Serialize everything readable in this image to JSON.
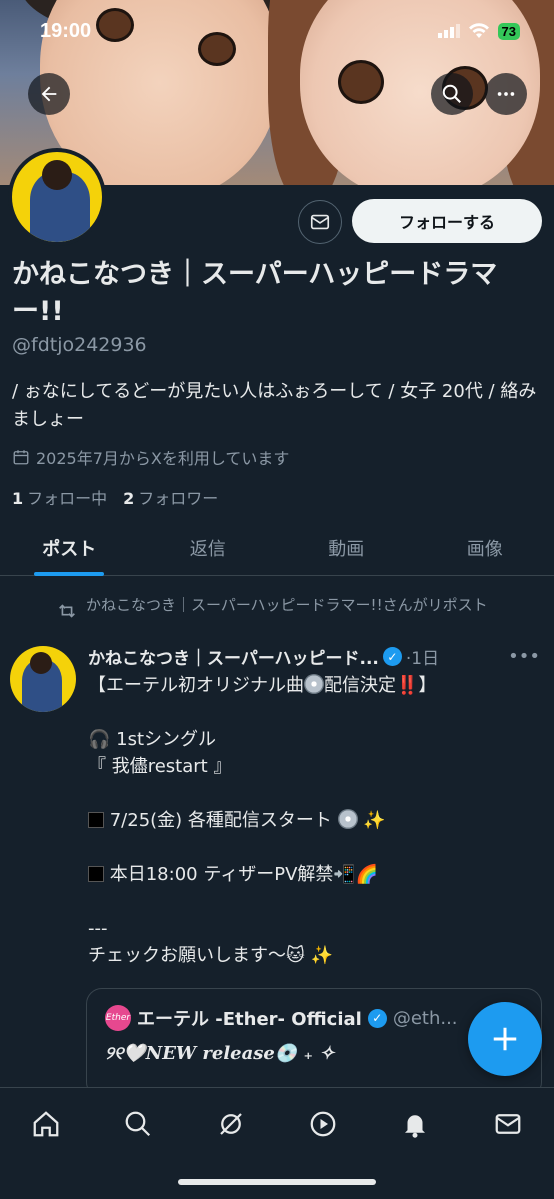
{
  "status_bar": {
    "time": "19:00",
    "battery": "73"
  },
  "profile": {
    "display_name": "かねこなつき｜スーパーハッピードラマー!!",
    "handle": "@fdtjo242936",
    "bio": "/ ぉなにしてるどーが見たい人はふぉろーして / 女子 20代 / 絡みましょー",
    "joined": "2025年7月からXを利用しています",
    "following_count": "1",
    "following_label": "フォロー中",
    "followers_count": "2",
    "followers_label": "フォロワー",
    "follow_button": "フォローする"
  },
  "tabs": [
    {
      "label": "ポスト",
      "active": true
    },
    {
      "label": "返信",
      "active": false
    },
    {
      "label": "動画",
      "active": false
    },
    {
      "label": "画像",
      "active": false
    }
  ],
  "post": {
    "repost_note": "かねこなつき｜スーパーハッピードラマー!!さんがリポスト",
    "author": "かねこなつき｜スーパーハッピード...",
    "time": "·1日",
    "lines": {
      "l1_a": "【エーテル初オリジナル曲",
      "l1_b": "配信決定",
      "l1_c": "‼️",
      "l1_d": "】",
      "l2": "🎧 1stシングル",
      "l3": "『 我儘restart 』",
      "l4": "7/25(金) 各種配信スタート",
      "l5": "本日18:00 ティザーPV解禁📲🌈",
      "l6": "---",
      "l7": "チェックお願いします〜🐱 ✨"
    },
    "quote": {
      "logo_text": "Ether",
      "name": "エーテル -Ether- Official",
      "handle": "@eth...",
      "text": "୨୧🤍NEW release💿 ₊ ✧"
    }
  },
  "icons": {
    "back": "back-arrow-icon",
    "search": "search-icon",
    "more": "more-icon",
    "mail": "mail-icon",
    "calendar": "calendar-icon",
    "repost": "repost-icon",
    "verified": "verified-icon",
    "compose": "plus-icon",
    "nav": [
      "home-icon",
      "search-icon",
      "grok-icon",
      "video-icon",
      "bell-icon",
      "mail-icon"
    ]
  },
  "colors": {
    "accent": "#1d9bf0",
    "background": "#15202b",
    "muted": "#8b98a5"
  }
}
